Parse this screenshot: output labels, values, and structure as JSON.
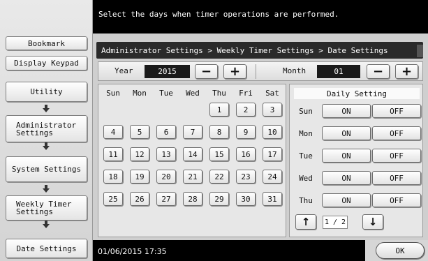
{
  "header": {
    "instruction": "Select the days when timer operations are performed."
  },
  "breadcrumb": "Administrator Settings > Weekly Timer Settings > Date Settings",
  "left_panel": {
    "bookmark": "Bookmark",
    "display_keypad": "Display Keypad",
    "steps": [
      {
        "label": [
          "Utility"
        ]
      },
      {
        "label": [
          "Administrator",
          "Settings"
        ]
      },
      {
        "label": [
          "System Settings"
        ]
      },
      {
        "label": [
          "Weekly Timer",
          "Settings"
        ]
      },
      {
        "label": [
          "Date Settings"
        ]
      }
    ]
  },
  "year": {
    "label": "Year",
    "value": "2015"
  },
  "month": {
    "label": "Month",
    "value": "01"
  },
  "stepper": {
    "minus": "−",
    "plus": "+"
  },
  "calendar": {
    "weekdays": [
      "Sun",
      "Mon",
      "Tue",
      "Wed",
      "Thu",
      "Fri",
      "Sat"
    ],
    "first_weekday_index": 4,
    "days": [
      "1",
      "2",
      "3",
      "4",
      "5",
      "6",
      "7",
      "8",
      "9",
      "10",
      "11",
      "12",
      "13",
      "14",
      "15",
      "16",
      "17",
      "18",
      "19",
      "20",
      "21",
      "22",
      "23",
      "24",
      "25",
      "26",
      "27",
      "28",
      "29",
      "30",
      "31"
    ]
  },
  "daily_setting": {
    "title": "Daily Setting",
    "on_label": "ON",
    "off_label": "OFF",
    "rows": [
      "Sun",
      "Mon",
      "Tue",
      "Wed",
      "Thu"
    ],
    "page_indicator": "1 / 2",
    "up_icon": "arrow-up-icon",
    "down_icon": "arrow-down-icon"
  },
  "footer": {
    "datetime": "01/06/2015  17:35",
    "ok_label": "OK"
  }
}
